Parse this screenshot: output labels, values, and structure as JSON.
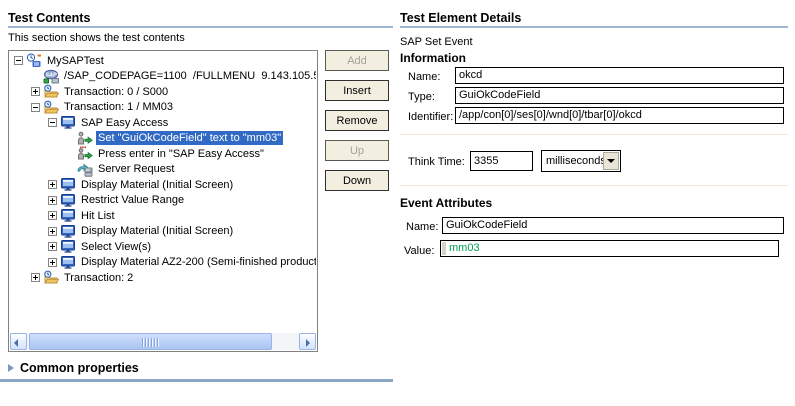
{
  "left_panel": {
    "title": "Test Contents",
    "subtitle": "This section shows the test contents",
    "tree": [
      {
        "level": 0,
        "expander": "minus",
        "icon": "sap-test-icon",
        "label": "MySAPTest",
        "selected": false
      },
      {
        "level": 1,
        "expander": "none",
        "icon": "sap-connection-icon",
        "label": "/SAP_CODEPAGE=1100  /FULLMENU  9.143.105.5",
        "selected": false
      },
      {
        "level": 1,
        "expander": "plus",
        "icon": "transaction-icon",
        "label": "Transaction: 0 / S000",
        "selected": false
      },
      {
        "level": 1,
        "expander": "minus",
        "icon": "transaction-icon",
        "label": "Transaction: 1 / MM03",
        "selected": false
      },
      {
        "level": 2,
        "expander": "minus",
        "icon": "screen-icon",
        "label": "SAP Easy Access",
        "selected": false
      },
      {
        "level": 3,
        "expander": "none",
        "icon": "set-event-icon",
        "label": "Set \"GuiOkCodeField\" text to \"mm03\"",
        "selected": true
      },
      {
        "level": 3,
        "expander": "none",
        "icon": "press-enter-icon",
        "label": "Press enter in \"SAP Easy Access\"",
        "selected": false
      },
      {
        "level": 3,
        "expander": "none",
        "icon": "server-request-icon",
        "label": "Server Request",
        "selected": false
      },
      {
        "level": 2,
        "expander": "plus",
        "icon": "screen-icon",
        "label": "Display Material (Initial Screen)",
        "selected": false
      },
      {
        "level": 2,
        "expander": "plus",
        "icon": "screen-icon",
        "label": "Restrict Value Range",
        "selected": false
      },
      {
        "level": 2,
        "expander": "plus",
        "icon": "screen-icon",
        "label": "Hit List",
        "selected": false
      },
      {
        "level": 2,
        "expander": "plus",
        "icon": "screen-icon",
        "label": "Display Material (Initial Screen)",
        "selected": false
      },
      {
        "level": 2,
        "expander": "plus",
        "icon": "screen-icon",
        "label": "Select View(s)",
        "selected": false
      },
      {
        "level": 2,
        "expander": "plus",
        "icon": "screen-icon",
        "label": "Display Material AZ2-200 (Semi-finished product",
        "selected": false
      },
      {
        "level": 1,
        "expander": "plus",
        "icon": "transaction-icon",
        "label": "Transaction: 2",
        "selected": false
      }
    ],
    "buttons": [
      {
        "label": "Add",
        "enabled": false
      },
      {
        "label": "Insert",
        "enabled": true
      },
      {
        "label": "Remove",
        "enabled": true
      },
      {
        "label": "Up",
        "enabled": false
      },
      {
        "label": "Down",
        "enabled": true
      }
    ],
    "common_properties_label": "Common properties"
  },
  "right_panel": {
    "title": "Test Element Details",
    "event_type": "SAP Set Event",
    "information": {
      "heading": "Information",
      "name_label": "Name:",
      "name_value": "okcd",
      "type_label": "Type:",
      "type_value": "GuiOkCodeField",
      "identifier_label": "Identifier:",
      "identifier_value": "/app/con[0]/ses[0]/wnd[0]/tbar[0]/okcd"
    },
    "think_time": {
      "label": "Think Time:",
      "value": "3355",
      "unit": "milliseconds"
    },
    "event_attributes": {
      "heading": "Event Attributes",
      "name_label": "Name:",
      "name_value": "GuiOkCodeField",
      "value_label": "Value:",
      "value_value": "mm03"
    }
  },
  "colors": {
    "selection_blue": "#316ac5",
    "header_rule": "#9db4d3",
    "common_rule": "#8da6c6",
    "value_green": "#00a050"
  }
}
